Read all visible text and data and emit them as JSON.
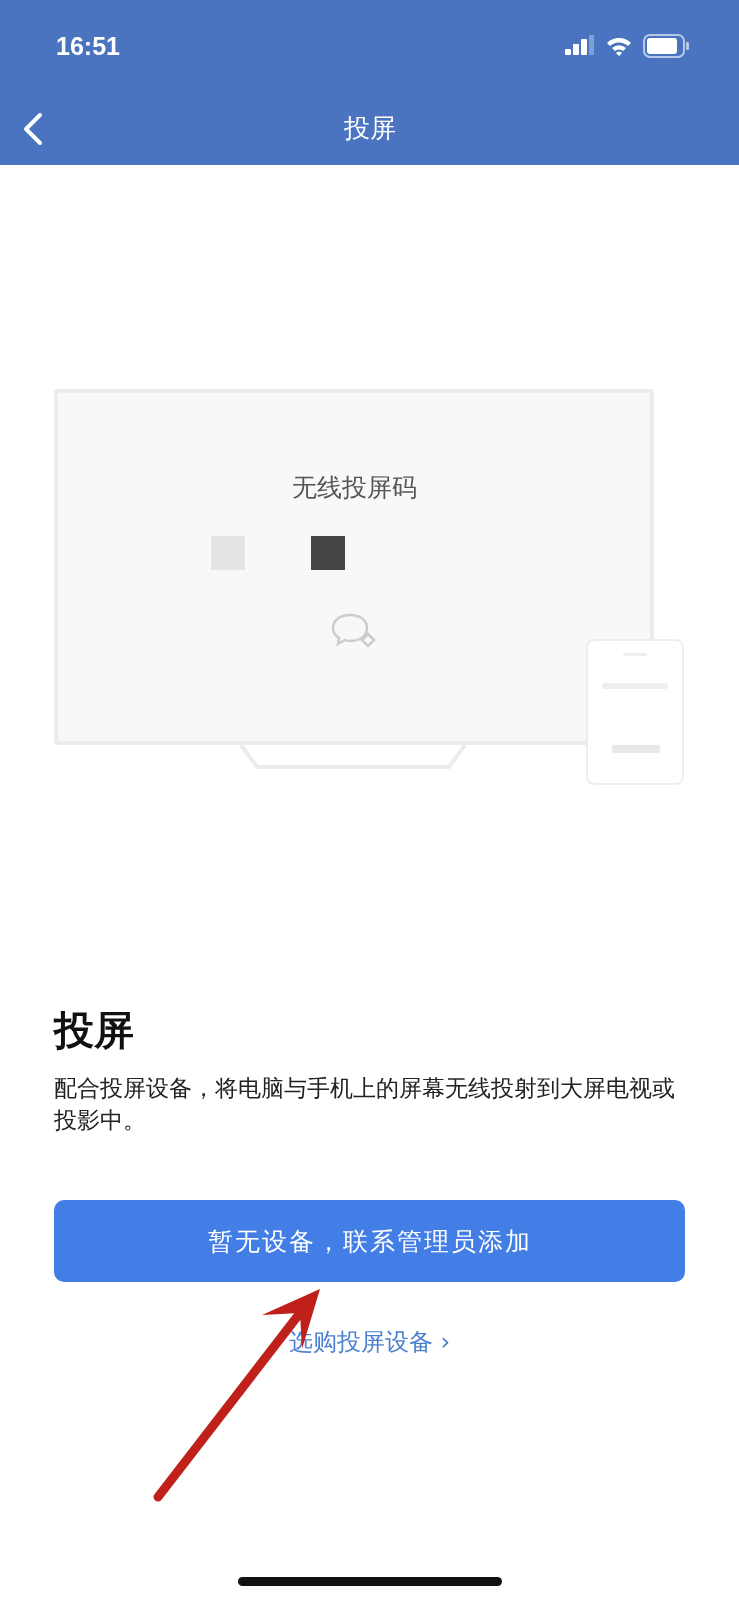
{
  "status_bar": {
    "time": "16:51"
  },
  "nav_bar": {
    "title": "投屏"
  },
  "illustration": {
    "code_title": "无线投屏码"
  },
  "intro": {
    "heading": "投屏",
    "description": "配合投屏设备，将电脑与手机上的屏幕无线投射到大屏电视或投影中。"
  },
  "primary_button": {
    "label": "暂无设备，联系管理员添加"
  },
  "link": {
    "label": "选购投屏设备",
    "chevron": "›"
  }
}
